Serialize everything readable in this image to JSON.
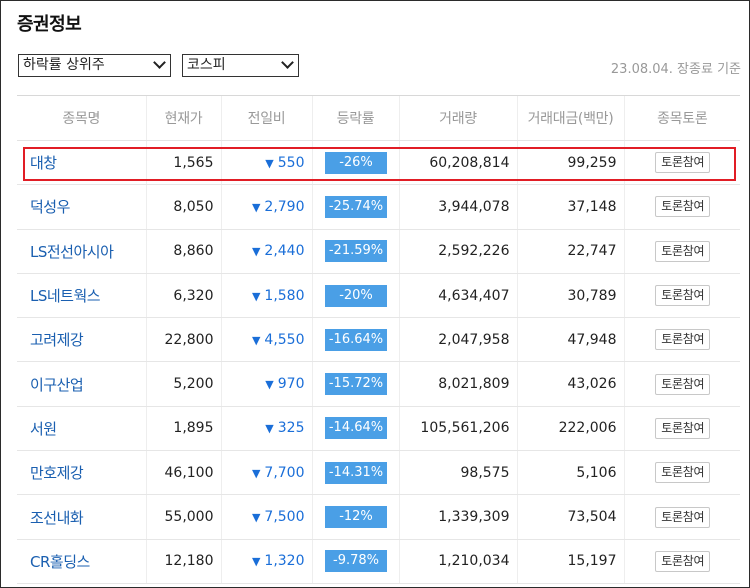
{
  "header": {
    "title": "증권정보"
  },
  "filters": {
    "ranking_select": "하락률 상위주",
    "market_select": "코스피",
    "basis_text": "23.08.04. 장종료 기준"
  },
  "table": {
    "columns": [
      "종목명",
      "현재가",
      "전일비",
      "등락률",
      "거래량",
      "거래대금(백만)",
      "종목토론"
    ],
    "rows": [
      {
        "name": "대창",
        "price": "1,565",
        "change": "550",
        "rate": "-26%",
        "volume": "60,208,814",
        "value": "99,259",
        "talk": "토론참여"
      },
      {
        "name": "덕성우",
        "price": "8,050",
        "change": "2,790",
        "rate": "-25.74%",
        "volume": "3,944,078",
        "value": "37,148",
        "talk": "토론참여"
      },
      {
        "name": "LS전선아시아",
        "price": "8,860",
        "change": "2,440",
        "rate": "-21.59%",
        "volume": "2,592,226",
        "value": "22,747",
        "talk": "토론참여"
      },
      {
        "name": "LS네트웍스",
        "price": "6,320",
        "change": "1,580",
        "rate": "-20%",
        "volume": "4,634,407",
        "value": "30,789",
        "talk": "토론참여"
      },
      {
        "name": "고려제강",
        "price": "22,800",
        "change": "4,550",
        "rate": "-16.64%",
        "volume": "2,047,958",
        "value": "47,948",
        "talk": "토론참여"
      },
      {
        "name": "이구산업",
        "price": "5,200",
        "change": "970",
        "rate": "-15.72%",
        "volume": "8,021,809",
        "value": "43,026",
        "talk": "토론참여"
      },
      {
        "name": "서원",
        "price": "1,895",
        "change": "325",
        "rate": "-14.64%",
        "volume": "105,561,206",
        "value": "222,006",
        "talk": "토론참여"
      },
      {
        "name": "만호제강",
        "price": "46,100",
        "change": "7,700",
        "rate": "-14.31%",
        "volume": "98,575",
        "value": "5,106",
        "talk": "토론참여"
      },
      {
        "name": "조선내화",
        "price": "55,000",
        "change": "7,500",
        "rate": "-12%",
        "volume": "1,339,309",
        "value": "73,504",
        "talk": "토론참여"
      },
      {
        "name": "CR홀딩스",
        "price": "12,180",
        "change": "1,320",
        "rate": "-9.78%",
        "volume": "1,210,034",
        "value": "15,197",
        "talk": "토론참여"
      }
    ]
  },
  "icons": {
    "down_arrow": "▼",
    "select_chevron": "chevron-down-icon"
  },
  "colors": {
    "rate_badge": "#4a9fe6",
    "down_text": "#1a6ed8",
    "highlight": "#e11d25",
    "link": "#1a5fb0"
  }
}
